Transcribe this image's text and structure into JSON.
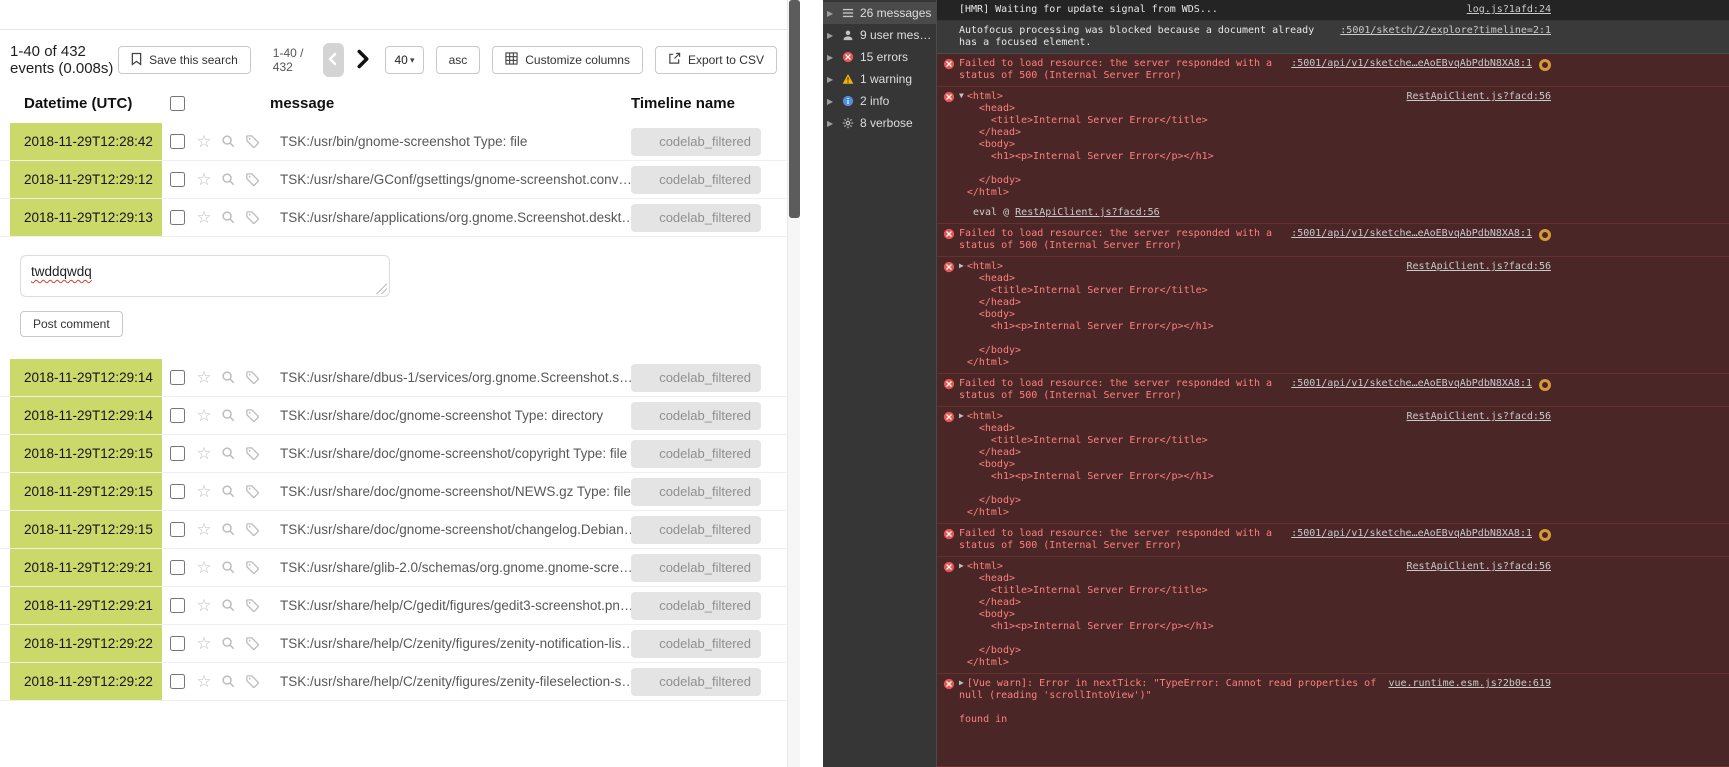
{
  "icons": {
    "star": "☆",
    "caret_down": "▾",
    "expanded": "▼",
    "collapsed": "▶"
  },
  "colors": {
    "event_highlight": "#cbd96b",
    "console_error_bg": "#4a2726",
    "console_error_text": "#ff7f7f",
    "error_icon_red": "#e55752",
    "warning_yellow": "#f2b400",
    "info_blue": "#4e8fe0",
    "issue_badge_amber": "#d79a35"
  },
  "app": {
    "summary": "1-40 of 432 events (0.008s)",
    "toolbar": {
      "save_search_label": "Save this search",
      "range_label": "1-40 / 432",
      "page_size_value": "40",
      "sort_label": "asc",
      "customize_label": "Customize columns",
      "export_label": "Export to CSV"
    },
    "table_headers": {
      "datetime": "Datetime (UTC)",
      "message": "message",
      "timeline": "Timeline name"
    },
    "comment": {
      "value": "twddqwdq",
      "post_label": "Post comment"
    },
    "events_before_comment": [
      {
        "datetime": "2018-11-29T12:28:42",
        "message": "TSK:/usr/bin/gnome-screenshot Type: file",
        "timeline": "codelab_filtered"
      },
      {
        "datetime": "2018-11-29T12:29:12",
        "message": "TSK:/usr/share/GConf/gsettings/gnome-screenshot.conv…",
        "timeline": "codelab_filtered"
      },
      {
        "datetime": "2018-11-29T12:29:13",
        "message": "TSK:/usr/share/applications/org.gnome.Screenshot.deskt…",
        "timeline": "codelab_filtered"
      }
    ],
    "events_after_comment": [
      {
        "datetime": "2018-11-29T12:29:14",
        "message": "TSK:/usr/share/dbus-1/services/org.gnome.Screenshot.s…",
        "timeline": "codelab_filtered"
      },
      {
        "datetime": "2018-11-29T12:29:14",
        "message": "TSK:/usr/share/doc/gnome-screenshot Type: directory",
        "timeline": "codelab_filtered"
      },
      {
        "datetime": "2018-11-29T12:29:15",
        "message": "TSK:/usr/share/doc/gnome-screenshot/copyright Type: file",
        "timeline": "codelab_filtered"
      },
      {
        "datetime": "2018-11-29T12:29:15",
        "message": "TSK:/usr/share/doc/gnome-screenshot/NEWS.gz Type: file",
        "timeline": "codelab_filtered"
      },
      {
        "datetime": "2018-11-29T12:29:15",
        "message": "TSK:/usr/share/doc/gnome-screenshot/changelog.Debian…",
        "timeline": "codelab_filtered"
      },
      {
        "datetime": "2018-11-29T12:29:21",
        "message": "TSK:/usr/share/glib-2.0/schemas/org.gnome.gnome-scre…",
        "timeline": "codelab_filtered"
      },
      {
        "datetime": "2018-11-29T12:29:21",
        "message": "TSK:/usr/share/help/C/gedit/figures/gedit3-screenshot.pn…",
        "timeline": "codelab_filtered"
      },
      {
        "datetime": "2018-11-29T12:29:22",
        "message": "TSK:/usr/share/help/C/zenity/figures/zenity-notification-lis…",
        "timeline": "codelab_filtered"
      },
      {
        "datetime": "2018-11-29T12:29:22",
        "message": "TSK:/usr/share/help/C/zenity/figures/zenity-fileselection-s…",
        "timeline": "codelab_filtered"
      }
    ]
  },
  "devtools": {
    "sidebar": [
      {
        "id": "messages",
        "label": "26 messages",
        "selected": true
      },
      {
        "id": "user-messages",
        "label": "9 user mes…",
        "selected": false
      },
      {
        "id": "errors",
        "label": "15 errors",
        "selected": false
      },
      {
        "id": "warnings",
        "label": "1 warning",
        "selected": false
      },
      {
        "id": "info",
        "label": "2 info",
        "selected": false
      },
      {
        "id": "verbose",
        "label": "8 verbose",
        "selected": false
      }
    ],
    "console": {
      "entries": [
        {
          "kind": "log",
          "text": "[HMR] Waiting for update signal from WDS...",
          "source": "log.js?1afd:24"
        },
        {
          "kind": "system",
          "text": "Autofocus processing was blocked because a document already has a focused element.",
          "source": ":5001/sketch/2/explore?timeline=2:1"
        },
        {
          "kind": "error",
          "text": "Failed to load resource: the server responded with a status of 500 (Internal Server Error)",
          "source": ":5001/api/v1/sketche…eAoEBvqAbPdbN8XA8:1",
          "issue_badge": true
        },
        {
          "kind": "error-html",
          "expanded": true,
          "source": "RestApiClient.js?facd:56",
          "lines": [
            "<html>",
            "  <head>",
            "    <title>Internal Server Error</title>",
            "  </head>",
            "  <body>",
            "    <h1><p>Internal Server Error</p></h1>",
            "",
            "  </body>",
            "</html>"
          ],
          "stack_prefix": "eval @ ",
          "stack_link": "RestApiClient.js?facd:56"
        },
        {
          "kind": "error",
          "text": "Failed to load resource: the server responded with a status of 500 (Internal Server Error)",
          "source": ":5001/api/v1/sketche…eAoEBvqAbPdbN8XA8:1",
          "issue_badge": true
        },
        {
          "kind": "error-html",
          "expanded": false,
          "source": "RestApiClient.js?facd:56",
          "lines": [
            "<html>",
            "  <head>",
            "    <title>Internal Server Error</title>",
            "  </head>",
            "  <body>",
            "    <h1><p>Internal Server Error</p></h1>",
            "",
            "  </body>",
            "</html>"
          ]
        },
        {
          "kind": "error",
          "text": "Failed to load resource: the server responded with a status of 500 (Internal Server Error)",
          "source": ":5001/api/v1/sketche…eAoEBvqAbPdbN8XA8:1",
          "issue_badge": true
        },
        {
          "kind": "error-html",
          "expanded": false,
          "source": "RestApiClient.js?facd:56",
          "lines": [
            "<html>",
            "  <head>",
            "    <title>Internal Server Error</title>",
            "  </head>",
            "  <body>",
            "    <h1><p>Internal Server Error</p></h1>",
            "",
            "  </body>",
            "</html>"
          ]
        },
        {
          "kind": "error",
          "text": "Failed to load resource: the server responded with a status of 500 (Internal Server Error)",
          "source": ":5001/api/v1/sketche…eAoEBvqAbPdbN8XA8:1",
          "issue_badge": true
        },
        {
          "kind": "error-html",
          "expanded": false,
          "source": "RestApiClient.js?facd:56",
          "lines": [
            "<html>",
            "  <head>",
            "    <title>Internal Server Error</title>",
            "  </head>",
            "  <body>",
            "    <h1><p>Internal Server Error</p></h1>",
            "",
            "  </body>",
            "</html>"
          ]
        },
        {
          "kind": "error",
          "disclosure": true,
          "text": "[Vue warn]: Error in nextTick: \"TypeError: Cannot read properties of null (reading 'scrollIntoView')\"",
          "source": "vue.runtime.esm.js?2b0e:619",
          "extra": "found in"
        }
      ]
    }
  }
}
